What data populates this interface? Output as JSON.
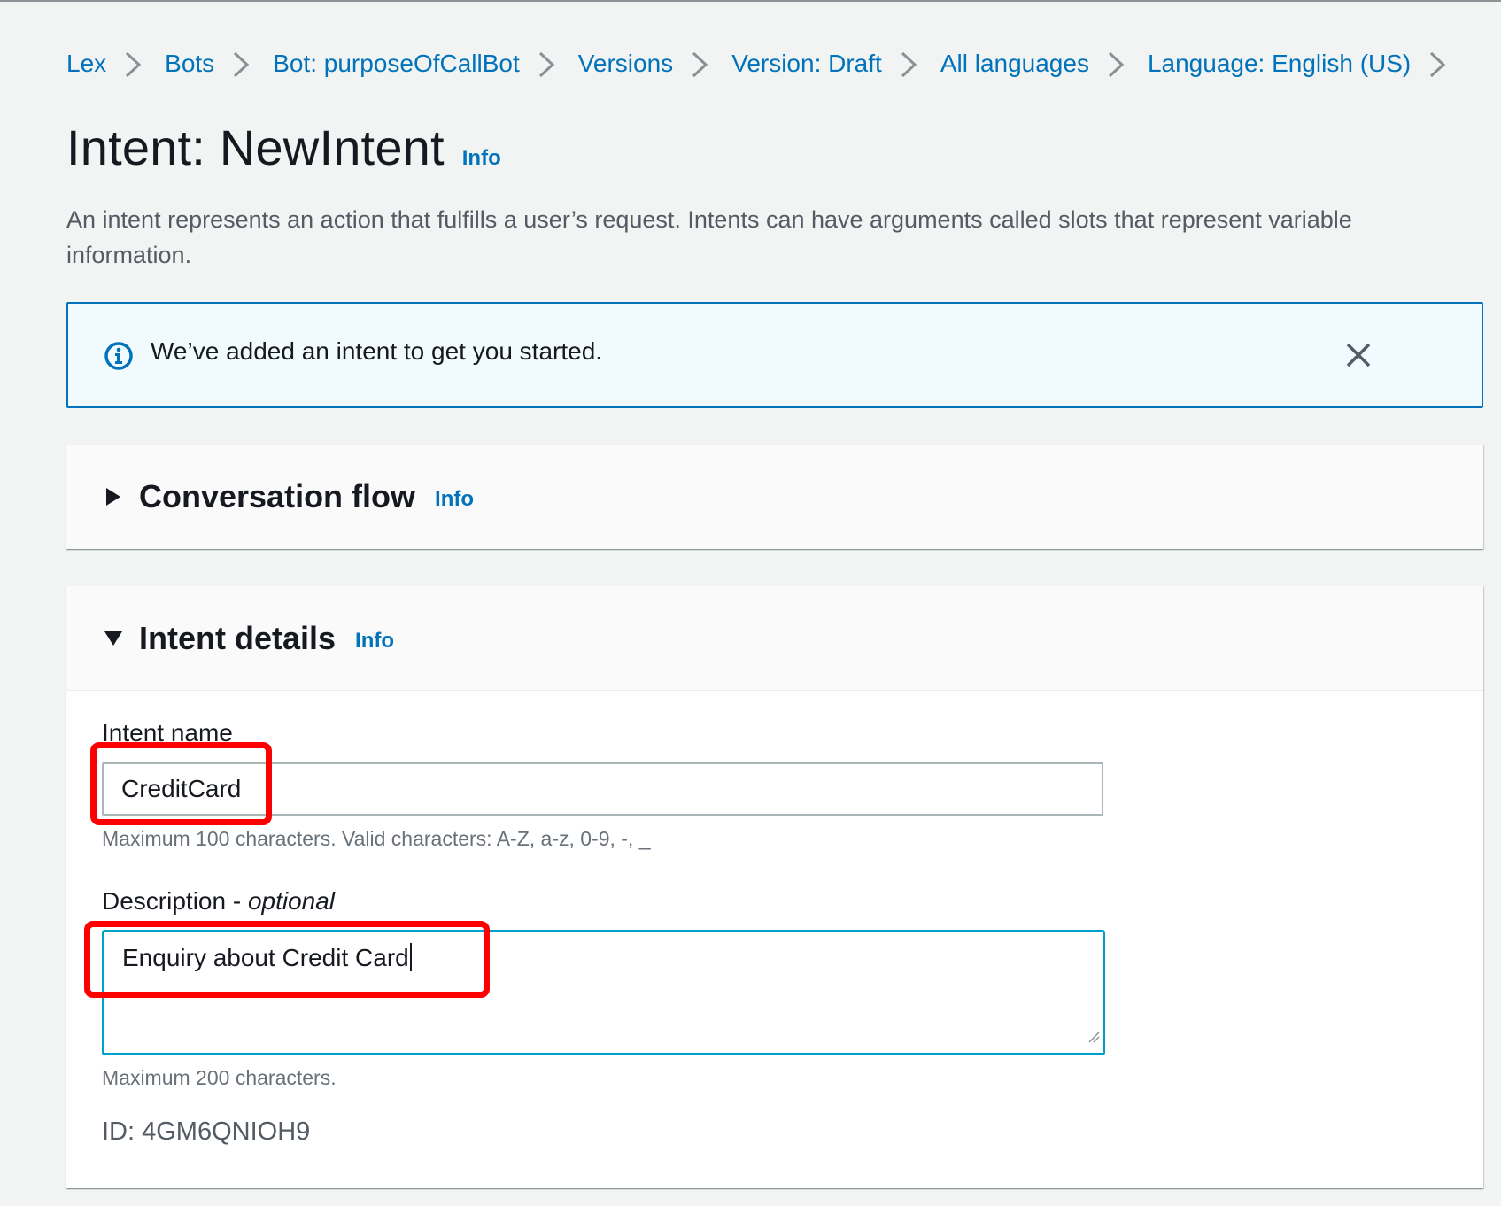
{
  "breadcrumb": {
    "items": [
      {
        "label": "Lex"
      },
      {
        "label": "Bots"
      },
      {
        "label": "Bot: purposeOfCallBot"
      },
      {
        "label": "Versions"
      },
      {
        "label": "Version: Draft"
      },
      {
        "label": "All languages"
      },
      {
        "label": "Language: English (US)"
      }
    ]
  },
  "header": {
    "title": "Intent: NewIntent",
    "info_label": "Info",
    "description": "An intent represents an action that fulfills a user’s request. Intents can have arguments called slots that represent variable information."
  },
  "flash": {
    "message": "We’ve added an intent to get you started."
  },
  "conversation_flow": {
    "title": "Conversation flow",
    "info_label": "Info"
  },
  "intent_details": {
    "title": "Intent details",
    "info_label": "Info",
    "name_label": "Intent name",
    "name_value": "CreditCard",
    "name_hint": "Maximum 100 characters. Valid characters: A-Z, a-z, 0-9, -, _",
    "description_label": "Description - ",
    "description_optional": "optional",
    "description_value": "Enquiry about Credit Card",
    "description_hint": "Maximum 200 characters.",
    "id_text": "ID: 4GM6QNIOH9"
  },
  "colors": {
    "link": "#0073bb",
    "flash_border": "#0073bb",
    "flash_bg": "#f1faff",
    "focus_border": "#00a1c9",
    "highlight": "#ff0000"
  }
}
